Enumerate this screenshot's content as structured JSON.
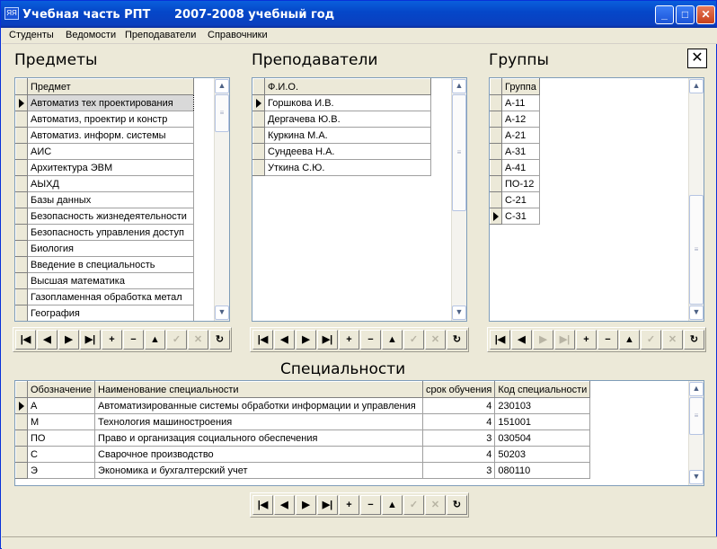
{
  "window": {
    "title": "Учебная часть РПТ",
    "year_title": "2007-2008 учебный год"
  },
  "menu": [
    "Студенты",
    "Ведомости",
    "Преподаватели",
    "Справочники"
  ],
  "subjects": {
    "title": "Предметы",
    "column": "Предмет",
    "rows": [
      "Автоматиз тех проектирования",
      "Автоматиз, проектир и констр",
      "Автоматиз. информ. системы",
      "АИС",
      "Архитектура ЭВМ",
      "АЫХД",
      "Базы данных",
      "Безопасность жизнедеятельности",
      "Безопасность управления доступ",
      "Биология",
      "Введение в специальность",
      "Высшая математика",
      "Газопламенная обработка метал",
      "География"
    ]
  },
  "teachers": {
    "title": "Преподаватели",
    "column": "Ф.И.О.",
    "rows": [
      "Горшкова И.В.",
      "Дергачева Ю.В.",
      "Куркина М.А.",
      "Сундеева Н.А.",
      "Уткина С.Ю."
    ]
  },
  "groups": {
    "title": "Группы",
    "column": "Группа",
    "rows": [
      "А-11",
      "А-12",
      "А-21",
      "А-31",
      "А-41",
      "ПО-12",
      "С-21",
      "С-31"
    ]
  },
  "specialties": {
    "title": "Специальности",
    "columns": [
      "Обозначение",
      "Наименование специальности",
      "срок обучения",
      "Код специальности"
    ],
    "rows": [
      [
        "А",
        "Автоматизированные системы обработки информации и управления",
        "4",
        "230103"
      ],
      [
        "М",
        "Технология машиностроения",
        "4",
        "151001"
      ],
      [
        "ПО",
        "Право и организация социального обеспечения",
        "3",
        "030504"
      ],
      [
        "С",
        "Сварочное производство",
        "4",
        "50203"
      ],
      [
        "Э",
        "Экономика и бухгалтерский учет",
        "3",
        "080110"
      ]
    ]
  },
  "nav_icons": [
    "first",
    "prior",
    "next",
    "last",
    "insert",
    "delete",
    "edit",
    "post",
    "cancel",
    "refresh"
  ],
  "nav_glyphs": {
    "first": "|◀",
    "prior": "◀",
    "next": "▶",
    "last": "▶|",
    "insert": "+",
    "delete": "−",
    "edit": "▲",
    "post": "✓",
    "cancel": "✕",
    "refresh": "↻"
  },
  "window_controls": {
    "minimize": "_",
    "maximize": "□",
    "close": "✕"
  },
  "panel_close_glyph": "✕",
  "app_icon_text": "ЯЯ",
  "scroll_glyphs": {
    "up": "▲",
    "down": "▼",
    "grip": "≡"
  },
  "colors": {
    "titlebar": "#0a5fdc",
    "face": "#ece9d8",
    "grid_border": "#7f9db9"
  }
}
